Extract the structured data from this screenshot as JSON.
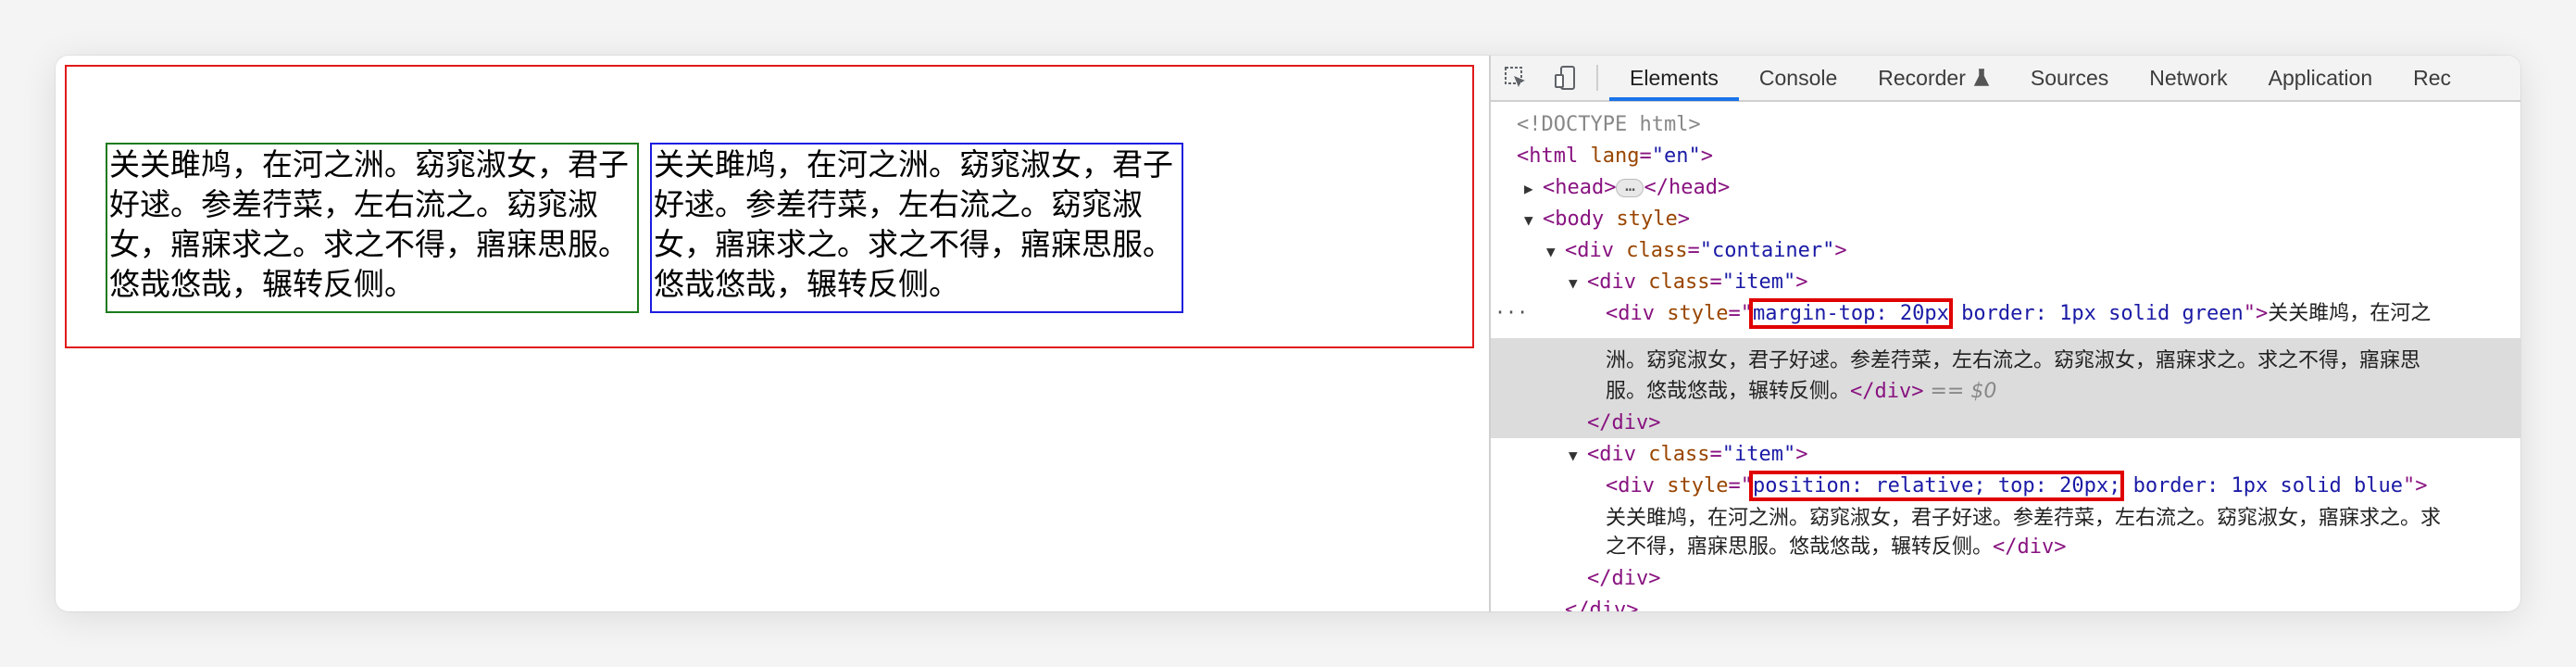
{
  "poem": "关关雎鸠，在河之洲。窈窕淑女，君子好逑。参差荇菜，左右流之。窈窕淑女，寤寐求之。求之不得，寤寐思服。悠哉悠哉，辗转反侧。",
  "poem_lines": [
    "关关雎鸠，在河之洲。窈窕淑女，君子",
    "好逑。参差荇菜，左右流之。窈窕淑",
    "女，寤寐求之。求之不得，寤寐思服。",
    "悠哉悠哉，辗转反侧。"
  ],
  "colors": {
    "container_border": "#e11a1a",
    "green_border": "#1c7a1c",
    "blue_border": "#1c1ce0",
    "highlight": "#e00000",
    "active_tab": "#1a73e8"
  },
  "devtools": {
    "tabs": [
      {
        "label": "Elements",
        "active": true
      },
      {
        "label": "Console"
      },
      {
        "label": "Recorder",
        "icon": "flask-icon"
      },
      {
        "label": "Sources"
      },
      {
        "label": "Network"
      },
      {
        "label": "Application"
      },
      {
        "label": "Rec"
      }
    ],
    "dom": {
      "doctype": "<!DOCTYPE html>",
      "html_open": "<html",
      "lang_attr": "lang",
      "lang_val": "\"en\"",
      "gt": ">",
      "head_open": "<head>",
      "ellipsis": "…",
      "head_close": "</head>",
      "body_open": "<body",
      "style_attr": "style",
      "div_open": "<div",
      "class_attr": "class",
      "container_val": "\"container\"",
      "item_val": "\"item\"",
      "eq_quote": "=\"",
      "quote": "\"",
      "margin_style": "margin-top: 20px",
      "green_style": " border: 1px solid green",
      "position_style": "position: relative; top: 20px;",
      "blue_style": " border: 1px solid blue",
      "text_1a": "关关雎鸠，在河之",
      "text_1b": "洲。窈窕淑女，君子好逑。参差荇菜，左右流之。窈窕淑女，寤寐求之。求之不得，寤寐思",
      "text_1c": "服。悠哉悠哉，辗转反侧。",
      "text_2a": "关关雎鸠，在河之洲。窈窕淑女，君子好逑。参差荇菜，左右流之。窈窕淑女，寤寐求之。求",
      "text_2b": "之不得，寤寐思服。悠哉悠哉，辗转反侧。",
      "div_close": "</div>",
      "eq_dollar": "== $0",
      "row_dots": "···"
    }
  }
}
